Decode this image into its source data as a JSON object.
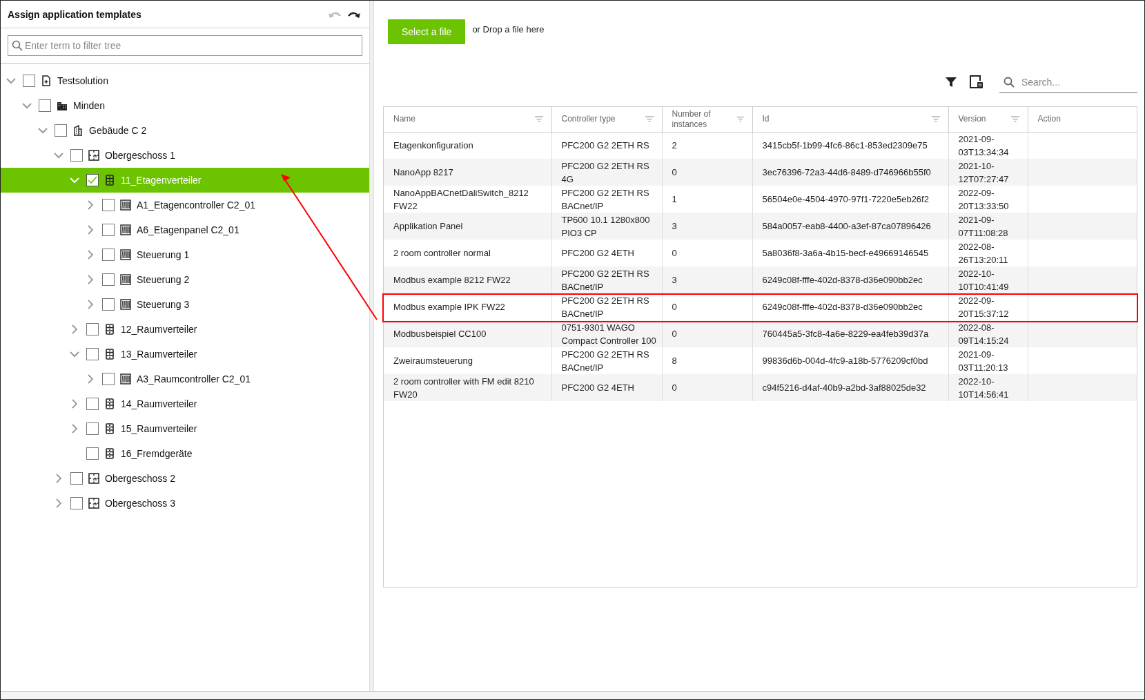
{
  "panel": {
    "title": "Assign application templates",
    "undo_disabled": true,
    "redo_disabled": false,
    "filter": {
      "placeholder": "Enter term to filter tree"
    }
  },
  "tree": [
    {
      "label": "Testsolution",
      "kind": "solution",
      "expandable": true,
      "expanded": true,
      "checked": false,
      "selected": false,
      "children": [
        {
          "label": "Minden",
          "kind": "site",
          "expandable": true,
          "expanded": true,
          "checked": false,
          "selected": false,
          "children": [
            {
              "label": "Gebäude C 2",
              "kind": "building",
              "expandable": true,
              "expanded": true,
              "checked": false,
              "selected": false,
              "children": [
                {
                  "label": "Obergeschoss 1",
                  "kind": "floor",
                  "expandable": true,
                  "expanded": true,
                  "checked": false,
                  "selected": false,
                  "children": [
                    {
                      "label": "11_Etagenverteiler",
                      "kind": "cabinet",
                      "expandable": true,
                      "expanded": true,
                      "checked": true,
                      "selected": true,
                      "children": [
                        {
                          "label": "A1_Etagencontroller C2_01",
                          "kind": "controller",
                          "expandable": true,
                          "expanded": false,
                          "checked": false,
                          "selected": false
                        },
                        {
                          "label": "A6_Etagenpanel C2_01",
                          "kind": "controller",
                          "expandable": true,
                          "expanded": false,
                          "checked": false,
                          "selected": false
                        },
                        {
                          "label": "Steuerung 1",
                          "kind": "controller",
                          "expandable": true,
                          "expanded": false,
                          "checked": false,
                          "selected": false
                        },
                        {
                          "label": "Steuerung 2",
                          "kind": "controller",
                          "expandable": true,
                          "expanded": false,
                          "checked": false,
                          "selected": false
                        },
                        {
                          "label": "Steuerung 3",
                          "kind": "controller",
                          "expandable": true,
                          "expanded": false,
                          "checked": false,
                          "selected": false
                        }
                      ]
                    },
                    {
                      "label": "12_Raumverteiler",
                      "kind": "cabinet",
                      "expandable": true,
                      "expanded": false,
                      "checked": false,
                      "selected": false
                    },
                    {
                      "label": "13_Raumverteiler",
                      "kind": "cabinet",
                      "expandable": true,
                      "expanded": true,
                      "checked": false,
                      "selected": false,
                      "children": [
                        {
                          "label": "A3_Raumcontroller C2_01",
                          "kind": "controller",
                          "expandable": true,
                          "expanded": false,
                          "checked": false,
                          "selected": false
                        }
                      ]
                    },
                    {
                      "label": "14_Raumverteiler",
                      "kind": "cabinet",
                      "expandable": true,
                      "expanded": false,
                      "checked": false,
                      "selected": false
                    },
                    {
                      "label": "15_Raumverteiler",
                      "kind": "cabinet",
                      "expandable": true,
                      "expanded": false,
                      "checked": false,
                      "selected": false
                    },
                    {
                      "label": "16_Fremdgeräte",
                      "kind": "cabinet",
                      "expandable": false,
                      "checked": false,
                      "selected": false
                    }
                  ]
                },
                {
                  "label": "Obergeschoss 2",
                  "kind": "floor",
                  "expandable": true,
                  "expanded": false,
                  "checked": false,
                  "selected": false
                },
                {
                  "label": "Obergeschoss 3",
                  "kind": "floor",
                  "expandable": true,
                  "expanded": false,
                  "checked": false,
                  "selected": false
                }
              ]
            }
          ]
        }
      ]
    }
  ],
  "upload": {
    "button": "Select a file",
    "hint": "or Drop a file here"
  },
  "search": {
    "placeholder": "Search..."
  },
  "table": {
    "columns": [
      {
        "label": "Name",
        "filter": true
      },
      {
        "label": "Controller type",
        "filter": true
      },
      {
        "label": "Number of instances",
        "filter": true
      },
      {
        "label": "Id",
        "filter": true
      },
      {
        "label": "Version",
        "filter": true
      },
      {
        "label": "Action",
        "filter": false
      }
    ],
    "rows": [
      {
        "cells": [
          "Etagenkonfiguration",
          "PFC200 G2 2ETH RS",
          "2",
          "3415cb5f-1b99-4fc6-86c1-853ed2309e75",
          "2021-09-03T13:34:34"
        ],
        "highlighted": false
      },
      {
        "cells": [
          "NanoApp 8217",
          "PFC200 G2 2ETH RS 4G",
          "0",
          "3ec76396-72a3-44d6-8489-d746966b55f0",
          "2021-10-12T07:27:47"
        ],
        "highlighted": false
      },
      {
        "cells": [
          "NanoAppBACnetDaliSwitch_8212 FW22",
          "PFC200 G2 2ETH RS BACnet/IP",
          "1",
          "56504e0e-4504-4970-97f1-7220e5eb26f2",
          "2022-09-20T13:33:50"
        ],
        "highlighted": false
      },
      {
        "cells": [
          "Applikation Panel",
          "TP600 10.1 1280x800 PIO3 CP",
          "3",
          "584a0057-eab8-4400-a3ef-87ca07896426",
          "2021-09-07T11:08:28"
        ],
        "highlighted": false
      },
      {
        "cells": [
          "2 room controller normal",
          "PFC200 G2 4ETH",
          "0",
          "5a8036f8-3a6a-4b15-becf-e49669146545",
          "2022-08-26T13:20:11"
        ],
        "highlighted": false
      },
      {
        "cells": [
          "Modbus example 8212 FW22",
          "PFC200 G2 2ETH RS BACnet/IP",
          "3",
          "6249c08f-fffe-402d-8378-d36e090bb2ec",
          "2022-10-10T10:41:49"
        ],
        "highlighted": false
      },
      {
        "cells": [
          "Modbus example IPK FW22",
          "PFC200 G2 2ETH RS BACnet/IP",
          "0",
          "6249c08f-fffe-402d-8378-d36e090bb2ec",
          "2022-09-20T15:37:12"
        ],
        "highlighted": true
      },
      {
        "cells": [
          "Modbusbeispiel CC100",
          "0751-9301 WAGO Compact Controller 100",
          "0",
          "760445a5-3fc8-4a6e-8229-ea4feb39d37a",
          "2022-08-09T14:15:24"
        ],
        "highlighted": false
      },
      {
        "cells": [
          "Zweiraumsteuerung",
          "PFC200 G2 2ETH RS BACnet/IP",
          "8",
          "99836d6b-004d-4fc9-a18b-5776209cf0bd",
          "2021-09-03T11:20:13"
        ],
        "highlighted": false
      },
      {
        "cells": [
          "2 room controller with FM edit 8210 FW20",
          "PFC200 G2 4ETH",
          "0",
          "c94f5216-d4af-40b9-a2bd-3af88025de32",
          "2022-10-10T14:56:41"
        ],
        "highlighted": false
      }
    ]
  },
  "callout_arrow": true
}
